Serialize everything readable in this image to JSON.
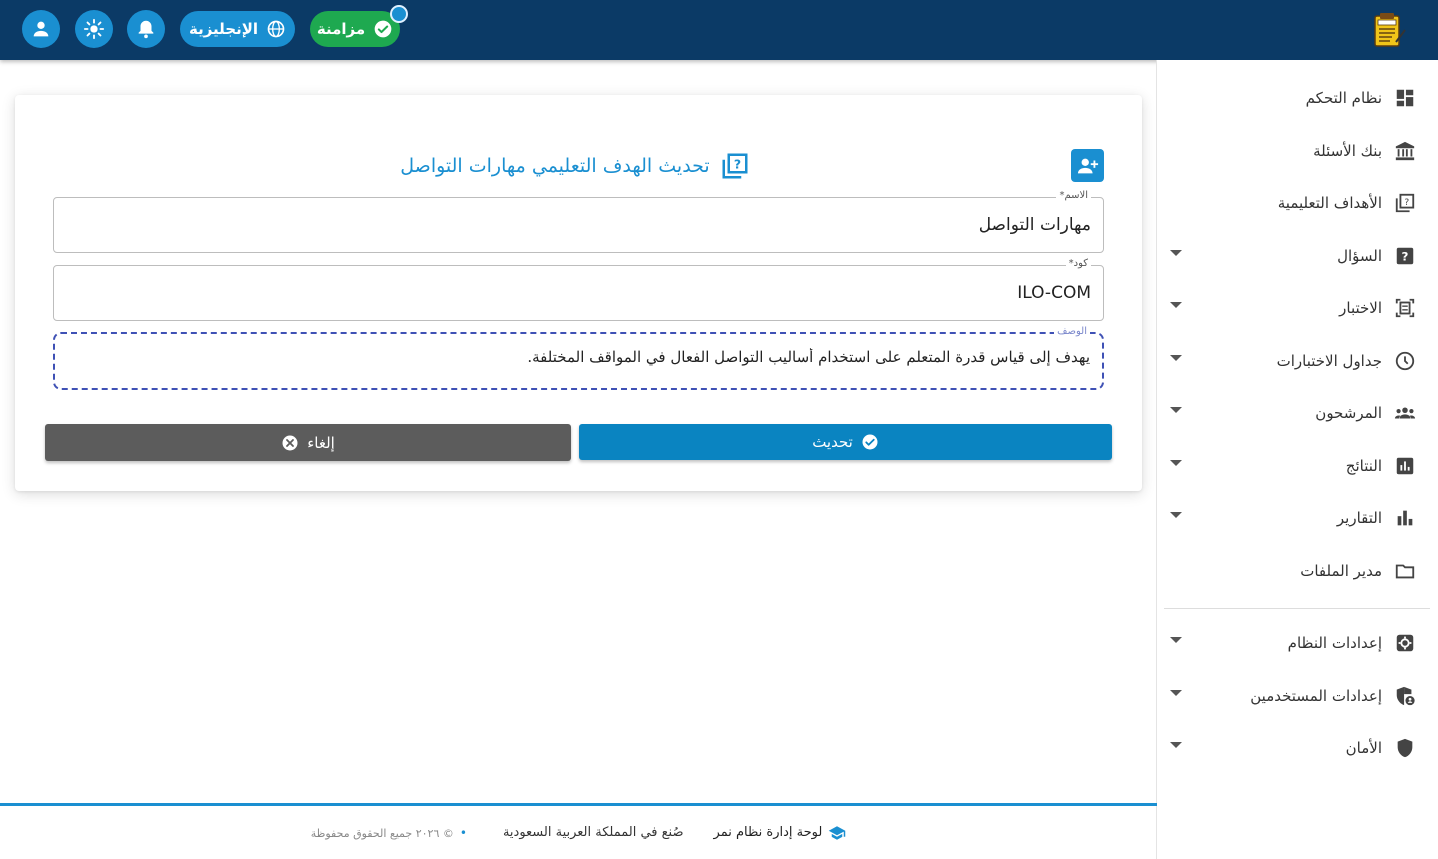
{
  "topbar": {
    "sync_label": "مزامنة",
    "language_label": "الإنجليزية",
    "icons": [
      "user-icon",
      "sun-icon",
      "bell-icon",
      "globe-icon",
      "check-circle-icon",
      "exam-logo-icon"
    ],
    "colors": {
      "bar": "#0b3a66",
      "accent": "#1a8fd1",
      "sync": "#1ea950"
    }
  },
  "sidebar": {
    "items": [
      {
        "label": "نظام التحكم",
        "icon": "dashboard-icon",
        "has_submenu": false
      },
      {
        "label": "بنك الأسئلة",
        "icon": "bank-icon",
        "has_submenu": false
      },
      {
        "label": "الأهداف التعليمية",
        "icon": "quiz-icon",
        "has_submenu": false
      },
      {
        "label": "السؤال",
        "icon": "help-box-icon",
        "has_submenu": true
      },
      {
        "label": "الاختبار",
        "icon": "document-scanner-icon",
        "has_submenu": true
      },
      {
        "label": "جداول الاختبارات",
        "icon": "clock-icon",
        "has_submenu": true
      },
      {
        "label": "المرشحون",
        "icon": "group-icon",
        "has_submenu": true
      },
      {
        "label": "النتائج",
        "icon": "assessment-icon",
        "has_submenu": true
      },
      {
        "label": "التقارير",
        "icon": "bar-chart-icon",
        "has_submenu": true
      },
      {
        "label": "مدير الملفات",
        "icon": "folder-icon",
        "has_submenu": false
      },
      {
        "label": "إعدادات النظام",
        "icon": "settings-icon",
        "has_submenu": true
      },
      {
        "label": "إعدادات المستخدمين",
        "icon": "admin-panel-icon",
        "has_submenu": true
      },
      {
        "label": "الأمان",
        "icon": "shield-icon",
        "has_submenu": true
      }
    ]
  },
  "form": {
    "title": "تحديث الهدف التعليمي مهارات التواصل",
    "name_label": "الاسم*",
    "name_value": "مهارات التواصل",
    "code_label": "كود*",
    "code_value": "ILO-COM",
    "description_label": "الوصف",
    "description_value": "يهدف إلى قياس قدرة المتعلم على استخدام أساليب التواصل الفعال في المواقف المختلفة.",
    "update_label": "تحديث",
    "cancel_label": "إلغاء"
  },
  "footer": {
    "brand": "لوحة إدارة نظام نمر",
    "made_in": "صُنع في المملكة العربية السعودية",
    "copyright": "© ٢٠٢٦ جميع الحقوق محفوظة"
  }
}
